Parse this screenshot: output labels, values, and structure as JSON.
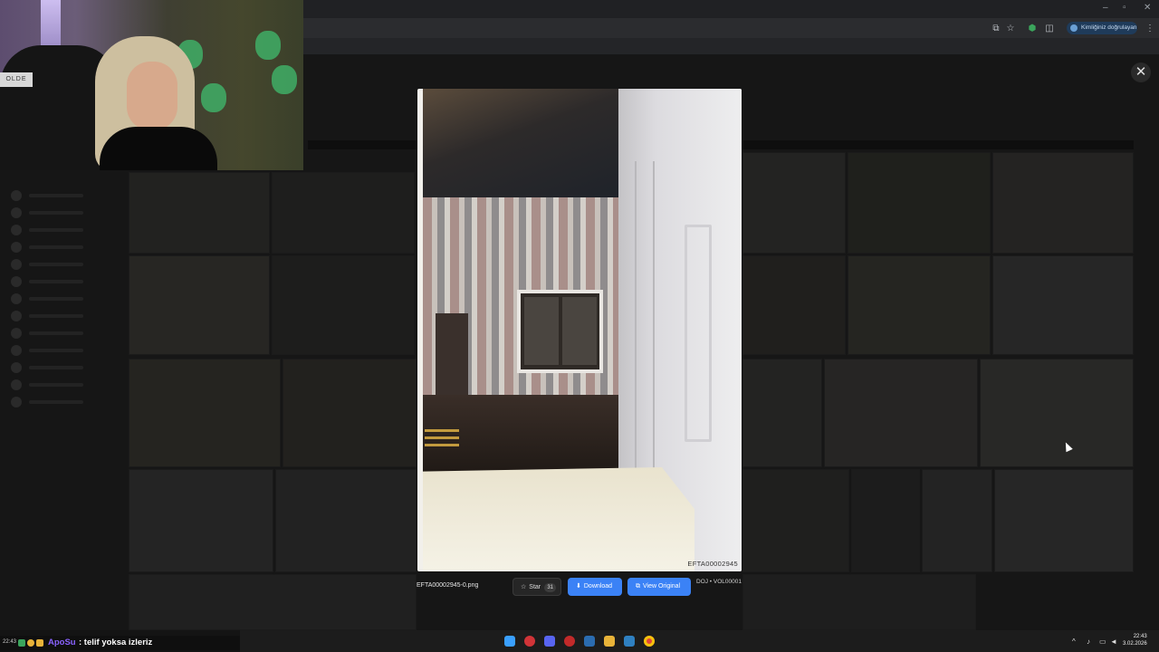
{
  "browser": {
    "profile_label": "Kimliğiniz doğrulayan",
    "window_controls": [
      "–",
      "▫",
      "✕"
    ]
  },
  "webcam": {
    "frame_text": "OLDE"
  },
  "modal": {
    "close_label": "✕",
    "watermark": "EFTA00002945",
    "file_name": "EFTA00002945-0.png",
    "star_label": "Star",
    "star_count": "31",
    "download_label": "Download",
    "view_original_label": "View Original",
    "meta": "DOJ • VOL00001"
  },
  "chat": {
    "time": "22:43",
    "user": "ApoSu",
    "message": ": telif yoksa izleriz"
  },
  "taskbar": {
    "clock_time": "22:43",
    "clock_date": "3.02.2026"
  },
  "colors": {
    "accent": "#3b82f6",
    "page_bg": "#161616",
    "chat_user": "#8a63ff"
  }
}
